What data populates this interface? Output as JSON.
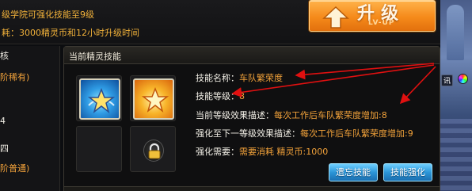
{
  "top": {
    "line1": "级学院可强化技能至9级",
    "line2": "耗：3000精灵币和12小时升级时间",
    "upgrade_button": {
      "label": "升级",
      "sublabel": "LV-UP"
    }
  },
  "left_list": {
    "items": [
      {
        "text": "核",
        "color": "white"
      },
      {
        "text": "阶稀有)",
        "color": "orange"
      },
      {
        "text": "4",
        "color": "white"
      },
      {
        "text": "四",
        "color": "white"
      },
      {
        "text": "阶普通)",
        "color": "orange"
      }
    ]
  },
  "background": {
    "tag": "讯"
  },
  "panel": {
    "title": "当前精灵技能",
    "icons": [
      "blue-star-skill-icon",
      "gold-star-skill-icon",
      "lock-icon"
    ],
    "info": {
      "name_label": "技能名称：",
      "name_value": "车队繁荣度",
      "level_label": "技能等级：",
      "level_value": "8",
      "current_label": "当前等级效果描述：",
      "current_value": "每次工作后车队繁荣度增加:8",
      "next_label": "强化至下一等级效果描述：",
      "next_value": "每次工作后车队繁荣度增加:9",
      "need_label": "强化需要：",
      "need_value": "需要消耗 精灵币:1000"
    },
    "buttons": {
      "forget": "遗忘技能",
      "enhance": "技能强化"
    },
    "next_section_title": ""
  },
  "colors": {
    "accent_orange": "#f2a23a",
    "button_blue": "#2b96d8",
    "annotation_red": "#e01010",
    "upgrade_orange": "#f58a1a"
  }
}
